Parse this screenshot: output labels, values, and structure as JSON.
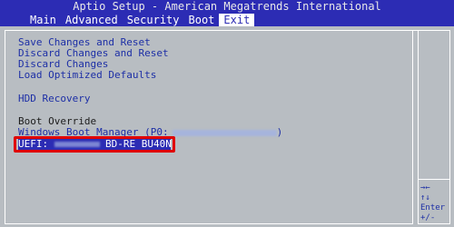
{
  "title": "Aptio Setup - American Megatrends International",
  "tabs": [
    {
      "label": "Main"
    },
    {
      "label": "Advanced"
    },
    {
      "label": "Security"
    },
    {
      "label": "Boot"
    },
    {
      "label": "Exit",
      "active": true
    }
  ],
  "menu": {
    "save_changes_reset": "Save Changes and Reset",
    "discard_changes_reset": "Discard Changes and Reset",
    "discard_changes": "Discard Changes",
    "load_optimized_defaults": "Load Optimized Defaults",
    "hdd_recovery": "HDD Recovery",
    "boot_override_label": "Boot Override",
    "windows_boot_manager": "Windows Boot Manager (P0:",
    "windows_boot_manager_suffix": ")",
    "uefi_prefix": "UEFI:",
    "uefi_device": "BD-RE BU40N"
  },
  "help": {
    "arrows_lr": "→←",
    "arrows_ud": "↑↓",
    "enter": "Enter",
    "plus_minus": "+/-"
  },
  "colors": {
    "bios_blue": "#2c2cb4",
    "panel_gray": "#b8bdc2",
    "highlight_red": "#e00000",
    "item_blue": "#1d2fa6"
  }
}
